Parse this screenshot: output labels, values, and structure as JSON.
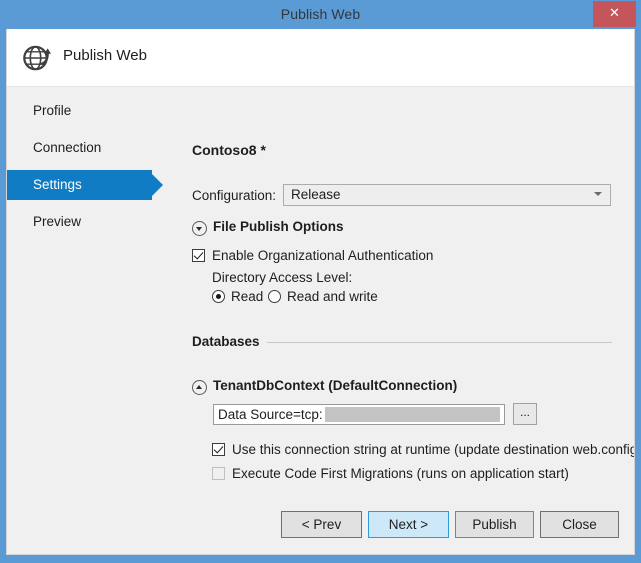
{
  "window": {
    "title": "Publish Web",
    "close_icon": "close-icon",
    "close_glyph": "✕",
    "title_bar_color": "#5b9bd5",
    "close_button_color": "#c4555a",
    "body_color": "#f0f0f0"
  },
  "header": {
    "title": "Publish Web",
    "icon": "globe-publish-icon"
  },
  "sidebar": {
    "items": [
      {
        "label": "Profile",
        "selected": false
      },
      {
        "label": "Connection",
        "selected": false
      },
      {
        "label": "Settings",
        "selected": true
      },
      {
        "label": "Preview",
        "selected": false
      }
    ],
    "selected_color": "#0f7cc4"
  },
  "main": {
    "page_heading": "Contoso8 *",
    "configuration": {
      "label": "Configuration:",
      "value": "Release",
      "chevron_icon": "chevron-down-icon"
    },
    "file_publish_options": {
      "title": "File Publish Options",
      "expander_icon": "chevron-down-circle-icon",
      "enable_org_auth": {
        "label": "Enable Organizational Authentication",
        "checked": true
      },
      "directory_access_label": "Directory Access Level:",
      "access_options": [
        {
          "label": "Read",
          "selected": true
        },
        {
          "label": "Read and write",
          "selected": false
        }
      ]
    },
    "databases": {
      "section_label": "Databases",
      "context": {
        "title": "TenantDbContext (DefaultConnection)",
        "expander_icon": "chevron-up-circle-icon"
      },
      "connection_string": {
        "value": "Data Source=tcp:",
        "redacted": true,
        "browse_label": "...",
        "browse_icon": "ellipsis-icon"
      },
      "options": [
        {
          "label": "Use this connection string at runtime (update destination web.config)",
          "checked": true,
          "disabled": false
        },
        {
          "label": "Execute Code First Migrations (runs on application start)",
          "checked": false,
          "disabled": true
        }
      ]
    }
  },
  "footer": {
    "buttons": [
      {
        "label": "< Prev",
        "state": "normal"
      },
      {
        "label": "Next >",
        "state": "hover"
      },
      {
        "label": "Publish",
        "state": "default"
      },
      {
        "label": "Close",
        "state": "normal"
      }
    ]
  }
}
